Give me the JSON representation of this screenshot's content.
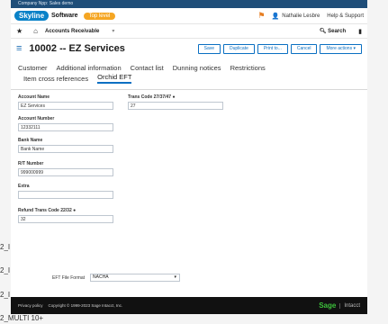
{
  "company_bar": {
    "text": "Company Npp: Sales demo"
  },
  "topbar": {
    "logo_mark": "Skyline",
    "logo_text": "Software",
    "trial_label": "Top level",
    "user_name": "Nathalie Lesbre",
    "help_label": "Help & Support"
  },
  "navbar": {
    "title": "Accounts Receivable",
    "search_label": "Search"
  },
  "header": {
    "title": "10002 -- EZ Services",
    "buttons": {
      "save": "Save",
      "duplicate": "Duplicate",
      "print": "Print to...",
      "cancel": "Cancel",
      "more": "More actions"
    }
  },
  "tabs": {
    "row1": [
      "Customer",
      "Additional information",
      "Contact list",
      "Dunning notices",
      "Restrictions"
    ],
    "row2": [
      "Item cross references",
      "Orchid EFT"
    ],
    "active": "Orchid EFT"
  },
  "form": {
    "account_name": {
      "label": "Account Name",
      "value": "EZ Services"
    },
    "trans_code_1": {
      "label": "Trans Code 27/37/47",
      "value": "27"
    },
    "account_number": {
      "label": "Account Number",
      "value": "12332111"
    },
    "bank_name": {
      "label": "Bank Name",
      "value": "Bank Name"
    },
    "rt_number": {
      "label": "R/T Number",
      "value": "999000999"
    },
    "extra": {
      "label": "Extra",
      "value": ""
    },
    "refund_trans_code": {
      "label": "Refund Trans Code 22/32",
      "value": "32"
    },
    "file_format": {
      "label": "EFT File Format",
      "value": "NACHA"
    }
  },
  "footer": {
    "privacy": "Privacy policy",
    "copyright": "Copyright © 1999-2023 Sage Intacct, Inc.",
    "brand": "Sage",
    "brand_sub": "Intacct"
  },
  "underlay": {
    "rows": [
      "2_I",
      "2_I",
      "2_I",
      "2_MULTI 10+"
    ]
  }
}
